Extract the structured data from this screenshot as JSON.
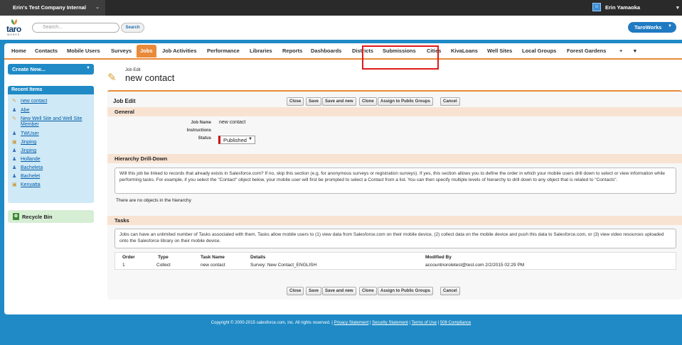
{
  "topbar": {
    "org": "Erin's Test Company Internal",
    "user": "Erin Yamaoka"
  },
  "header": {
    "logo": "taro",
    "logo_sub": "WORKS",
    "search_placeholder": "Search...",
    "search_button": "Search",
    "app_menu": "TaroWorks"
  },
  "tabs": [
    "Home",
    "Contacts",
    "Mobile Users",
    "Surveys",
    "Jobs",
    "Job Activities",
    "Performance",
    "Libraries",
    "Reports",
    "Dashboards",
    "Districts",
    "Submissions",
    "Cities",
    "KivaLoans",
    "Well Sites",
    "Local Groups",
    "Forest Gardens",
    "+"
  ],
  "active_tab": "Jobs",
  "sidebar": {
    "create_new": "Create New...",
    "recent_title": "Recent Items",
    "recent": [
      {
        "icon": "pencil-icon",
        "label": "new contact"
      },
      {
        "icon": "person-icon",
        "label": "Abe"
      },
      {
        "icon": "pencil-icon",
        "label": "New Well Site and Well Site Member"
      },
      {
        "icon": "person-icon",
        "label": "TWUser"
      },
      {
        "icon": "badge-icon",
        "label": "Jinping"
      },
      {
        "icon": "person-icon",
        "label": "Jinping"
      },
      {
        "icon": "person-icon",
        "label": "Hollande"
      },
      {
        "icon": "person-icon",
        "label": "Bacheleta"
      },
      {
        "icon": "person-icon",
        "label": "Bachelet"
      },
      {
        "icon": "badge-icon",
        "label": "Kenyatta"
      }
    ],
    "recycle": "Recycle Bin"
  },
  "page": {
    "subtitle": "Job Edit",
    "title": "new contact"
  },
  "edit": {
    "title": "Job Edit",
    "buttons": [
      "Close",
      "Save",
      "Save and new",
      "Clone",
      "Assign to Public Groups",
      "Cancel"
    ],
    "general": "General",
    "fields": {
      "job_name_label": "Job Name",
      "job_name": "new contact",
      "instructions_label": "Instructions",
      "status_label": "Status",
      "status": "Published"
    },
    "hierarchy": "Hierarchy Drill-Down",
    "hierarchy_help": "Will this job be linked to records that already exists in Salesforce.com? If no, skip this section (e.g. for anonymous surveys or registration surveys). If yes, this section allows you to define the order in which your mobile users drill down to select or view information while performing tasks. For example, if you select the \"Contact\" object below, your mobile user will first be prompted to select a Contact from a list. You can then specify multiple levels of hierarchy to drill down to any object that is related to \"Contacts\".",
    "hierarchy_empty": "There are no objects in the hierarchy",
    "tasks": "Tasks",
    "tasks_help": "Jobs can have an unlimited number of Tasks associated with them. Tasks allow mobile users to (1) view data from Salesforce.com on their mobile device, (2) collect data on the mobile device and push this data to Salesforce.com, or (3) view video resources uploaded onto the Salesforce library on their mobile device.",
    "table": {
      "headers": [
        "Order",
        "Type",
        "Task Name",
        "Details",
        "Modified By"
      ],
      "rows": [
        [
          "1",
          "Collect",
          "new contact",
          "Survey: New Contact_ENGLISH",
          "accountnoroletest@test.com  2/2/2015 02:29 PM"
        ]
      ]
    }
  },
  "footer": {
    "copyright": "Copyright © 2000-2015 salesforce.com, inc. All rights reserved. |",
    "links": [
      "Privacy Statement",
      "Security Statement",
      "Terms of Use",
      "508 Compliance"
    ]
  },
  "colors": {
    "accent": "#e88a3a",
    "brand": "#1f8ac6",
    "highlight": "#e01919"
  }
}
